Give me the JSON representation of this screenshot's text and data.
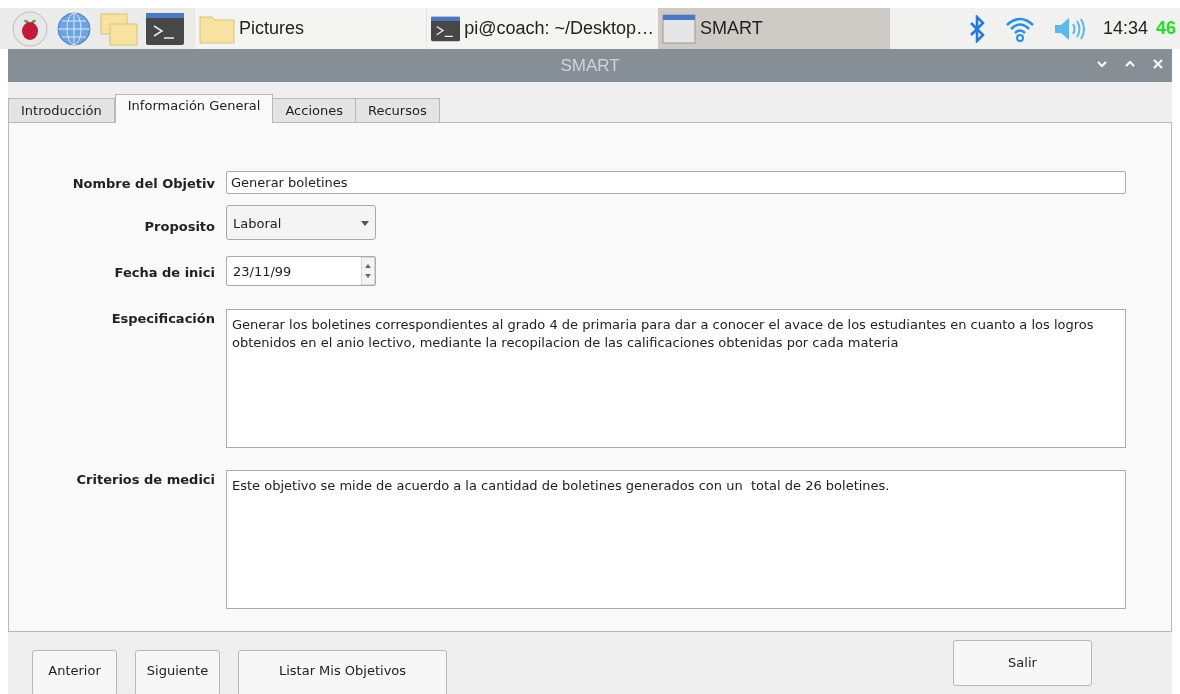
{
  "taskbar": {
    "tasks": [
      {
        "kind": "folder",
        "label": "Pictures",
        "selected": false
      },
      {
        "kind": "terminal",
        "label": "pi@coach: ~/Desktop…",
        "selected": false
      },
      {
        "kind": "window",
        "label": "SMART",
        "selected": true
      }
    ],
    "clock": "14:34",
    "battery": "46"
  },
  "window": {
    "title": "SMART"
  },
  "tabs": [
    {
      "label": "Introducción",
      "selected": false
    },
    {
      "label": "Información General",
      "selected": true
    },
    {
      "label": "Acciones",
      "selected": false
    },
    {
      "label": "Recursos",
      "selected": false
    }
  ],
  "fields": [
    {
      "kind": "text",
      "label": "Nombre del Objetiv",
      "value": "Generar boletines"
    },
    {
      "kind": "combo",
      "label": "Proposito",
      "value": "Laboral"
    },
    {
      "kind": "date",
      "label": "Fecha de inici",
      "value": "23/11/99"
    },
    {
      "kind": "textarea",
      "label": "Especificación",
      "value": "Generar los boletines correspondientes al grado 4 de primaria para dar a conocer el avace de los estudiantes en cuanto a los logros obtenidos en el anio lectivo, mediante la recopilacion de las calificaciones obtenidas por cada materia"
    },
    {
      "kind": "textarea",
      "label": "Criterios de medici",
      "value": "Este objetivo se mide de acuerdo a la cantidad de boletines generados con un  total de 26 boletines."
    }
  ],
  "buttons": [
    {
      "label": "Anterior"
    },
    {
      "label": "Siguiente"
    },
    {
      "label": "Listar Mis Objetivos"
    },
    {
      "label": "Salir"
    }
  ]
}
